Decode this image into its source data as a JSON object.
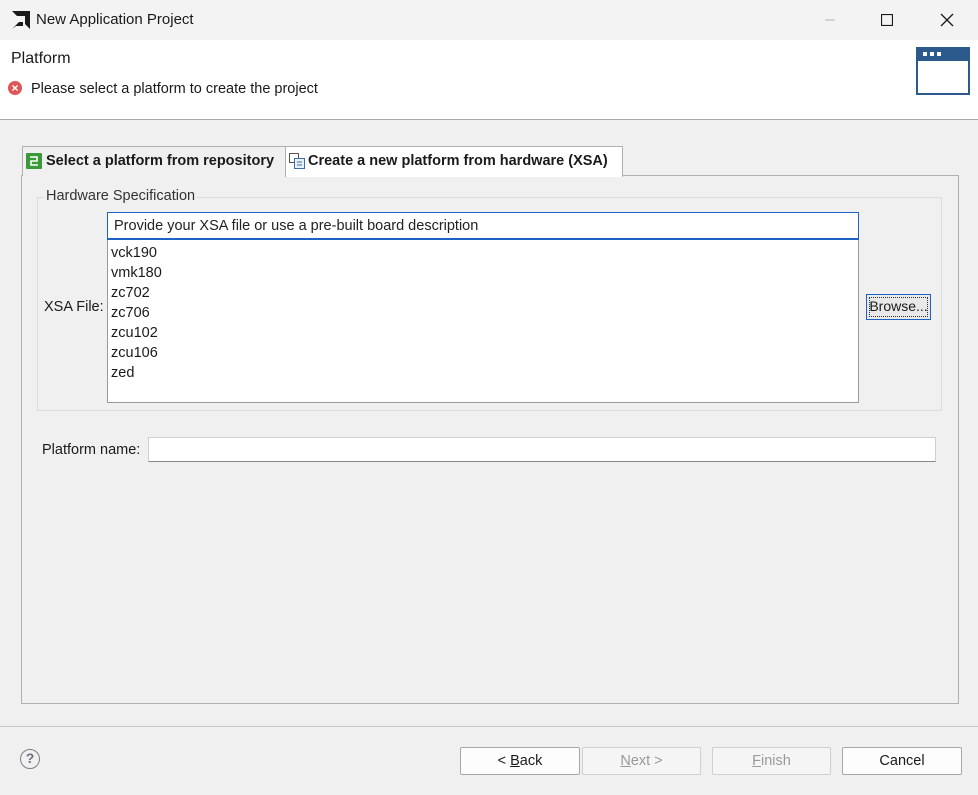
{
  "window": {
    "title": "New Application Project",
    "icon": "amd-logo-icon"
  },
  "header": {
    "title": "Platform",
    "error_message": "Please select a platform to create the project"
  },
  "tabs": [
    {
      "label": "Select a platform from repository",
      "icon": "repository-icon",
      "selected": false
    },
    {
      "label": "Create a new platform from hardware (XSA)",
      "icon": "hardware-icon",
      "selected": true
    }
  ],
  "hardware_spec": {
    "group_title": "Hardware Specification",
    "xsa_label": "XSA File:",
    "xsa_value": "Provide your XSA file or use a pre-built board description",
    "boards": [
      "vck190",
      "vmk180",
      "zc702",
      "zc706",
      "zcu102",
      "zcu106",
      "zed"
    ],
    "browse_label": "Browse..."
  },
  "platform_name": {
    "label": "Platform name:",
    "value": ""
  },
  "footer": {
    "back_prefix": "< ",
    "back_mnemonic": "B",
    "back_rest": "ack",
    "next_mnemonic": "N",
    "next_rest": "ext >",
    "finish_mnemonic": "F",
    "finish_rest": "inish",
    "cancel_label": "Cancel"
  },
  "colors": {
    "error": "#e05555",
    "focus": "#1f62c6",
    "selected_tab": "#ffffff"
  }
}
